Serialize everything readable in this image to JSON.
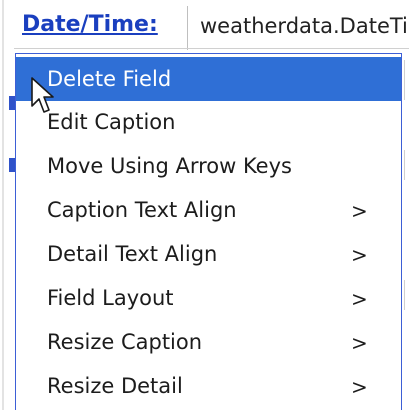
{
  "background": {
    "caption": "Date/Time:",
    "value": "weatherdata.DateTime"
  },
  "context_menu": {
    "items": [
      {
        "label": "Delete Field",
        "has_submenu": false,
        "submenu_glyph": "",
        "selected": true
      },
      {
        "label": "Edit Caption",
        "has_submenu": false,
        "submenu_glyph": "",
        "selected": false
      },
      {
        "label": "Move Using Arrow Keys",
        "has_submenu": false,
        "submenu_glyph": "",
        "selected": false
      },
      {
        "label": "Caption Text Align",
        "has_submenu": true,
        "submenu_glyph": ">",
        "selected": false
      },
      {
        "label": "Detail Text Align",
        "has_submenu": true,
        "submenu_glyph": ">",
        "selected": false
      },
      {
        "label": "Field Layout",
        "has_submenu": true,
        "submenu_glyph": ">",
        "selected": false
      },
      {
        "label": "Resize Caption",
        "has_submenu": true,
        "submenu_glyph": ">",
        "selected": false
      },
      {
        "label": "Resize Detail",
        "has_submenu": true,
        "submenu_glyph": ">",
        "selected": false
      }
    ]
  },
  "colors": {
    "selection": "#2f6fd6",
    "menu_border": "#3d5fd6",
    "caption_text": "#1a3fbf"
  },
  "icons": {
    "cursor": "mouse-pointer-icon"
  }
}
